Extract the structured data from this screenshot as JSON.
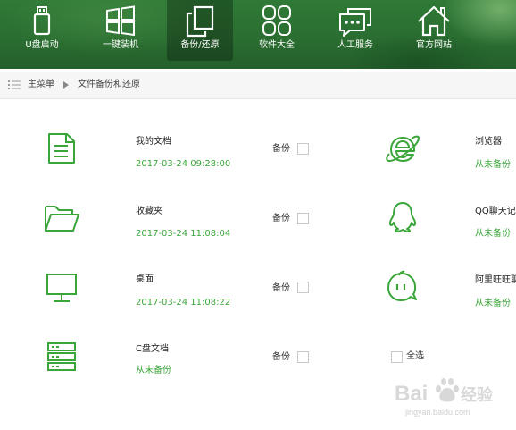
{
  "toolbar": {
    "items": [
      {
        "label": "U盘启动",
        "icon": "usb-drive-icon"
      },
      {
        "label": "一键装机",
        "icon": "windows-logo-icon"
      },
      {
        "label": "备份/还原",
        "icon": "copy-pages-icon",
        "active": true
      },
      {
        "label": "软件大全",
        "icon": "apps-grid-icon"
      },
      {
        "label": "人工服务",
        "icon": "chat-bubble-icon"
      },
      {
        "label": "官方网站",
        "icon": "home-icon"
      }
    ]
  },
  "breadcrumb": {
    "root": "主菜单",
    "current": "文件备份和还原"
  },
  "backups": {
    "button_label": "备份",
    "items": [
      {
        "name": "我的文档",
        "status": "2017-03-24 09:28:00",
        "icon": "document-icon"
      },
      {
        "name": "收藏夹",
        "status": "2017-03-24 11:08:04",
        "icon": "folder-icon"
      },
      {
        "name": "桌面",
        "status": "2017-03-24 11:08:22",
        "icon": "monitor-icon"
      },
      {
        "name": "C盘文档",
        "status": "从未备份",
        "icon": "server-icon"
      }
    ]
  },
  "apps": {
    "items": [
      {
        "name": "浏览器",
        "status": "从未备份",
        "icon": "ie-browser-icon"
      },
      {
        "name": "QQ聊天记",
        "status": "从未备份",
        "icon": "qq-penguin-icon"
      },
      {
        "name": "阿里旺旺聊",
        "status": "从未备份",
        "icon": "wangwang-icon"
      }
    ],
    "select_all_label": "全选"
  },
  "watermark": {
    "brand": "Bai",
    "suffix": "经验",
    "url": "jingyan.baidu.com"
  },
  "colors": {
    "accent_green": "#3aa63a",
    "toolbar_green": "#2a6e31"
  }
}
